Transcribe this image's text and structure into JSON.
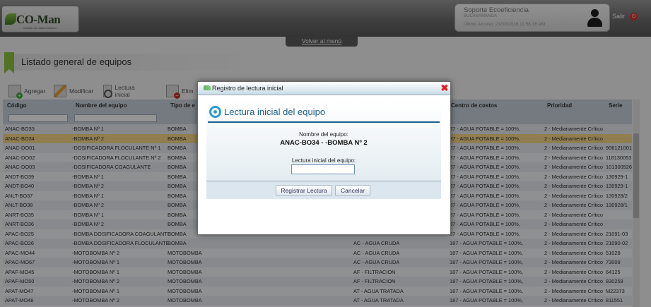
{
  "header": {
    "logo_text": "CO-Man",
    "logo_sub": "Gestión de mantenimiento",
    "user_name": "Soporte Ecoeficiencia",
    "user_city": "BUCARAMANGA",
    "last_access": "Último Acceso: 21/09/2016 11:58:16 AM",
    "logout_label": "Salir",
    "back_menu_label": "Volver al menú"
  },
  "page": {
    "title": "Listado general de equipos"
  },
  "toolbar": {
    "add_label": "Agregar",
    "modify_label": "Modificar",
    "reading_label": "Lectura inicial",
    "delete_label": "Elim"
  },
  "grid": {
    "columns": [
      "Código",
      "Nombre del equipo",
      "Tipo de e",
      "",
      "Centro de costos",
      "Prioridad",
      "Serie"
    ],
    "rows": [
      {
        "code": "ANAC-BO33",
        "name": "-BOMBA Nº 1",
        "type": "BOMBA",
        "area": "",
        "cost": "87 - AGUA POTABLE = 100%,",
        "prio": "2 - Medianamente Crítico",
        "serie": ""
      },
      {
        "code": "ANAC-BO34",
        "name": "-BOMBA Nº 2",
        "type": "BOMBA",
        "area": "",
        "cost": "87 - AGUA POTABLE = 100%,",
        "prio": "2 - Medianamente Crítico",
        "serie": ""
      },
      {
        "code": "ANAC-DO01",
        "name": "-DOSIFICADORA FLOCULANTE Nº 1",
        "type": "BOMBA",
        "area": "",
        "cost": "87 - AGUA POTABLE = 100%,",
        "prio": "2 - Medianamente Crítico",
        "serie": "906121001"
      },
      {
        "code": "ANAC-DO02",
        "name": "-DOSIFICADORA FLOCULANTE Nº 2",
        "type": "BOMBA",
        "area": "",
        "cost": "87 - AGUA POTABLE = 100%,",
        "prio": "2 - Medianamente Crítico",
        "serie": "118130053"
      },
      {
        "code": "ANAC-DO03",
        "name": "-DOSIFICADORA COAGULANTE",
        "type": "BOMBA",
        "area": "",
        "cost": "87 - AGUA POTABLE = 100%,",
        "prio": "2 - Medianamente Crítico",
        "serie": "101300526"
      },
      {
        "code": "ANDT-BO39",
        "name": "-BOMBA Nº 1",
        "type": "BOMBA",
        "area": "",
        "cost": "87 - AGUA POTABLE = 100%,",
        "prio": "2 - Medianamente Crítico",
        "serie": "130929-1"
      },
      {
        "code": "ANDT-BO40",
        "name": "-BOMBA Nº 2",
        "type": "BOMBA",
        "area": "",
        "cost": "87 - AGUA POTABLE = 100%,",
        "prio": "2 - Medianamente Crítico",
        "serie": "130929-1"
      },
      {
        "code": "ANLT-BO37",
        "name": "-BOMBA Nº 1",
        "type": "BOMBA",
        "area": "",
        "cost": "87 - AGUA POTABLE = 100%,",
        "prio": "2 - Medianamente Crítico",
        "serie": "130928/2"
      },
      {
        "code": "ANLT-BO38",
        "name": "-BOMBA Nº 2",
        "type": "BOMBA",
        "area": "",
        "cost": "87 - AGUA POTABLE = 100%,",
        "prio": "2 - Medianamente Crítico",
        "serie": "130928/1"
      },
      {
        "code": "ANRT-BO35",
        "name": "-BOMBA Nº 1",
        "type": "BOMBA",
        "area": "",
        "cost": "87 - AGUA POTABLE = 100%,",
        "prio": "2 - Medianamente Crítico",
        "serie": ""
      },
      {
        "code": "ANRT-BO36",
        "name": "-BOMBA Nº 2",
        "type": "BOMBA",
        "area": "",
        "cost": "87 - AGUA POTABLE = 100%,",
        "prio": "2 - Medianamente Crítico",
        "serie": ""
      },
      {
        "code": "APAC-BO25",
        "name": "-BOMBA DOSIFICADORA COAGULANTE",
        "type": "BOMBA",
        "area": "",
        "cost": "87 - AGUA POTABLE = 100%,",
        "prio": "2 - Medianamente Crítico",
        "serie": "21091-03"
      },
      {
        "code": "APAC-BO26",
        "name": "-BOMBA DOSIFICADORA FLOCULANTE",
        "type": "BOMBA",
        "area": "AC - AGUA CRUDA",
        "cost": "187 - AGUA POTABLE = 100%,",
        "prio": "2 - Medianamente Crítico",
        "serie": "21090-02"
      },
      {
        "code": "APAC-MO44",
        "name": "-MOTOBOMBA Nº 2",
        "type": "MOTOBOMBA",
        "area": "AC - AGUA CRUDA",
        "cost": "187 - AGUA POTABLE = 100%,",
        "prio": "2 - Medianamente Crítico",
        "serie": "51028"
      },
      {
        "code": "APAC-MO67",
        "name": "-MOTOBOMBA Nº 1",
        "type": "MOTOBOMBA",
        "area": "AC - AGUA CRUDA",
        "cost": "187 - AGUA POTABLE = 100%,",
        "prio": "2 - Medianamente Crítico",
        "serie": "73009"
      },
      {
        "code": "APAF-MO45",
        "name": "-MOTOBOMBA Nº 1",
        "type": "MOTOBOMBA",
        "area": "AF - FILTRACION",
        "cost": "187 - AGUA POTABLE = 100%,",
        "prio": "2 - Medianamente Crítico",
        "serie": "64125"
      },
      {
        "code": "APAF-MO50",
        "name": "-MOTOBOMBA Nº 2",
        "type": "MOTOBOMBA",
        "area": "AF - FILTRACION",
        "cost": "187 - AGUA POTABLE = 100%,",
        "prio": "2 - Medianamente Crítico",
        "serie": "830259"
      },
      {
        "code": "APAT-MO47",
        "name": "-MOTOBOMBA Nº 1",
        "type": "MOTOBOMBA",
        "area": "AT - AGUA TRATADA",
        "cost": "187 - AGUA POTABLE = 100%,",
        "prio": "2 - Medianamente Crítico",
        "serie": "M22373"
      },
      {
        "code": "APAT-MO48",
        "name": "-MOTOBOMBA Nº 2",
        "type": "MOTOBOMBA",
        "area": "AT - AGUA TRATADA",
        "cost": "187 - AGUA POTABLE = 100%,",
        "prio": "2 - Medianamente Crítico",
        "serie": "811551"
      }
    ],
    "selected_row": 1
  },
  "modal": {
    "title": "Registro de lectura inicial",
    "heading": "Lectura inicial del equipo",
    "name_label": "Nombre del equipo:",
    "name_value": "ANAC-BO34 - -BOMBA Nº 2",
    "reading_label": "Lectura inicial del equipo:",
    "reading_value": "",
    "register_button": "Registrar Lectura",
    "cancel_button": "Cancelar",
    "close_glyph": "✖"
  },
  "colors": {
    "accent_green": "#8dc63f",
    "heading_blue": "#1f5f8a",
    "selected_row": "#f9d98a",
    "close_red": "#dd2222"
  },
  "icons": {
    "logout": "power-icon",
    "add": "add-document-icon",
    "modify": "edit-pencil-icon",
    "reading": "meter-icon",
    "delete": "delete-icon",
    "user": "user-silhouette-icon"
  }
}
